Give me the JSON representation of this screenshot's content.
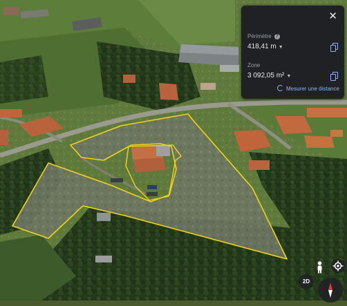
{
  "measure_panel": {
    "perimeter_label": "Périmètre",
    "perimeter_value": "418,41 m",
    "area_label": "Zone",
    "area_value": "3 092,05 m²",
    "measure_distance_label": "Mesurer une distance",
    "accent_color": "#8ab4f8",
    "panel_color": "#202124"
  },
  "map_controls": {
    "view_toggle_label": "2D",
    "pegman_icon": "pegman-icon",
    "location_icon": "my-location-icon",
    "compass_icon": "compass-icon"
  },
  "overlay": {
    "polygon_color": "#f2d21a"
  }
}
